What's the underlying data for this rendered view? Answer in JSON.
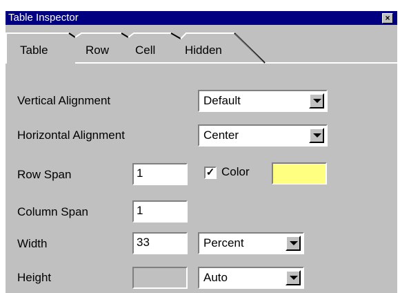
{
  "window": {
    "title": "Table Inspector",
    "close_glyph": "×"
  },
  "tabs": [
    {
      "label": "Table",
      "active": false
    },
    {
      "label": "Row",
      "active": false
    },
    {
      "label": "Cell",
      "active": true
    },
    {
      "label": "Hidden",
      "active": false
    }
  ],
  "cell": {
    "vertical_alignment": {
      "label": "Vertical Alignment",
      "value": "Default"
    },
    "horizontal_alignment": {
      "label": "Horizontal Alignment",
      "value": "Center"
    },
    "row_span": {
      "label": "Row Span",
      "value": "1"
    },
    "color": {
      "label": "Color",
      "checked": true,
      "check_glyph": "✓",
      "swatch": "#ffff80"
    },
    "column_span": {
      "label": "Column Span",
      "value": "1"
    },
    "width": {
      "label": "Width",
      "value": "33",
      "unit": "Percent"
    },
    "height": {
      "label": "Height",
      "value": "",
      "unit": "Auto"
    }
  }
}
